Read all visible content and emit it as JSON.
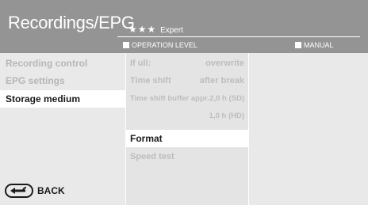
{
  "header": {
    "title": "Recordings/EPG",
    "level_stars": "★★★",
    "level_label": "Expert",
    "legend_operation": "OPERATION LEVEL",
    "legend_manual": "MANUAL"
  },
  "menu": {
    "items": [
      {
        "label": "Recording control"
      },
      {
        "label": "EPG settings"
      },
      {
        "label": "Storage medium"
      }
    ]
  },
  "settings": {
    "if_full": {
      "label": "If ull:",
      "value": "overwrite"
    },
    "time_shift": {
      "label": "Time shift",
      "value": "after break"
    },
    "buffer": {
      "label": "Time shift buffer appr...",
      "value_sd": "2,0 h (SD)",
      "value_hd": "1,0 h (HD)"
    },
    "format": {
      "label": "Format"
    },
    "speed_test": {
      "label": "Speed test"
    }
  },
  "footer": {
    "back_label": "BACK"
  },
  "colors": {
    "header_bg": "#949494",
    "panel_bg": "#e9e9e9",
    "highlight": "#ffffff",
    "inactive_text": "#b6b6b6",
    "active_text": "#1a1a1a"
  },
  "icons": {
    "back": "back-arrow-icon"
  }
}
